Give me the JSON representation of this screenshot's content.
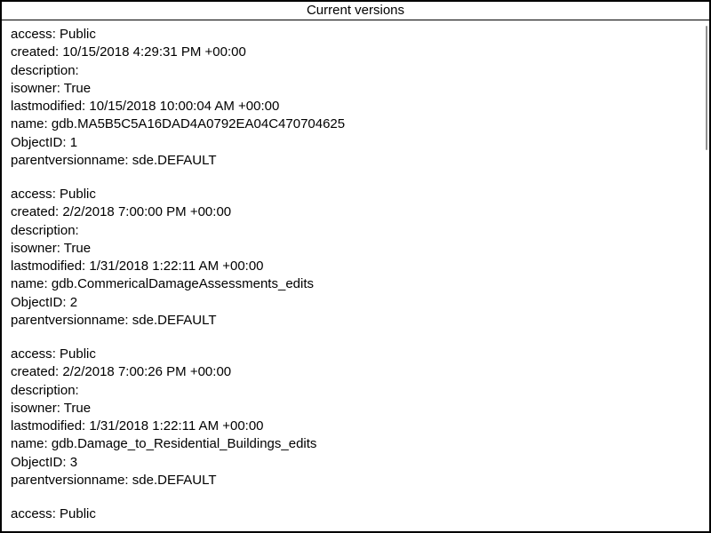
{
  "title": "Current versions",
  "field_labels": {
    "access": "access",
    "created": "created",
    "description": "description",
    "isowner": "isowner",
    "lastmodified": "lastmodified",
    "name": "name",
    "objectid": "ObjectID",
    "parentversionname": "parentversionname"
  },
  "records": [
    {
      "access": "Public",
      "created": "10/15/2018 4:29:31 PM +00:00",
      "description": "",
      "isowner": "True",
      "lastmodified": "10/15/2018 10:00:04 AM +00:00",
      "name": "gdb.MA5B5C5A16DAD4A0792EA04C470704625",
      "objectid": "1",
      "parentversionname": "sde.DEFAULT"
    },
    {
      "access": "Public",
      "created": "2/2/2018 7:00:00 PM +00:00",
      "description": "",
      "isowner": "True",
      "lastmodified": "1/31/2018 1:22:11 AM +00:00",
      "name": "gdb.CommericalDamageAssessments_edits",
      "objectid": "2",
      "parentversionname": "sde.DEFAULT"
    },
    {
      "access": "Public",
      "created": "2/2/2018 7:00:26 PM +00:00",
      "description": "",
      "isowner": "True",
      "lastmodified": "1/31/2018 1:22:11 AM +00:00",
      "name": "gdb.Damage_to_Residential_Buildings_edits",
      "objectid": "3",
      "parentversionname": "sde.DEFAULT"
    },
    {
      "access": "Public",
      "created": "",
      "description": "",
      "isowner": "",
      "lastmodified": "",
      "name": "",
      "objectid": "",
      "parentversionname": ""
    }
  ]
}
